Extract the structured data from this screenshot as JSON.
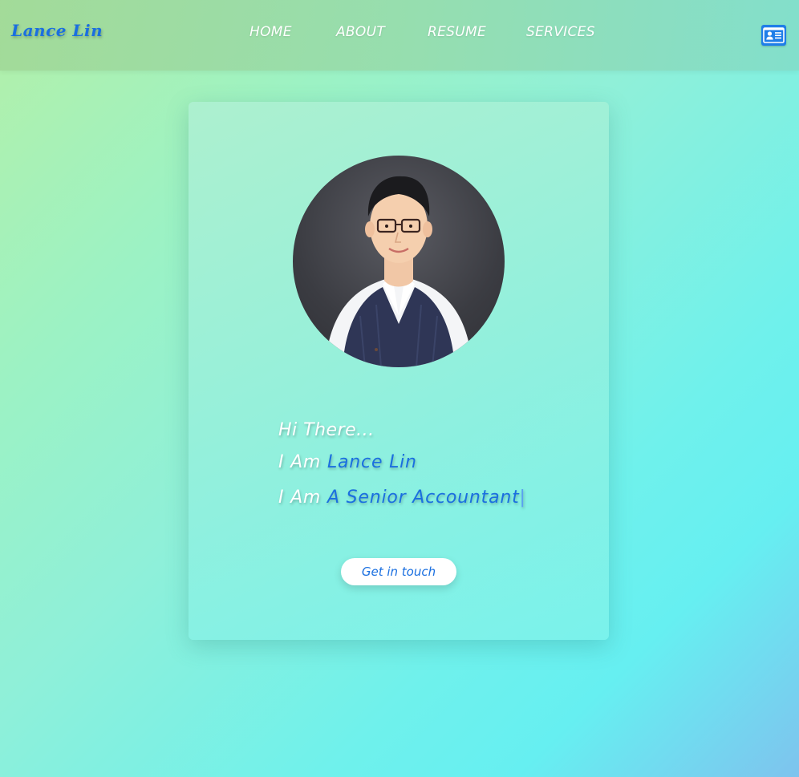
{
  "brand": {
    "name": "Lance Lin"
  },
  "nav": {
    "items": [
      {
        "label": "HOME"
      },
      {
        "label": "ABOUT"
      },
      {
        "label": "RESUME"
      },
      {
        "label": "SERVICES"
      }
    ]
  },
  "header_actions": {
    "contact_icon": "contact-card-icon"
  },
  "hero": {
    "greeting": "Hi There...",
    "name_prefix": "I Am",
    "name": "Lance Lin",
    "role_prefix": "I Am",
    "role": "A Senior Accountant",
    "cursor": "|",
    "cta_label": "Get in touch"
  },
  "colors": {
    "accent": "#1a6fe0",
    "button_bg": "#ffffff",
    "icon_bg": "#1f7ee8"
  }
}
